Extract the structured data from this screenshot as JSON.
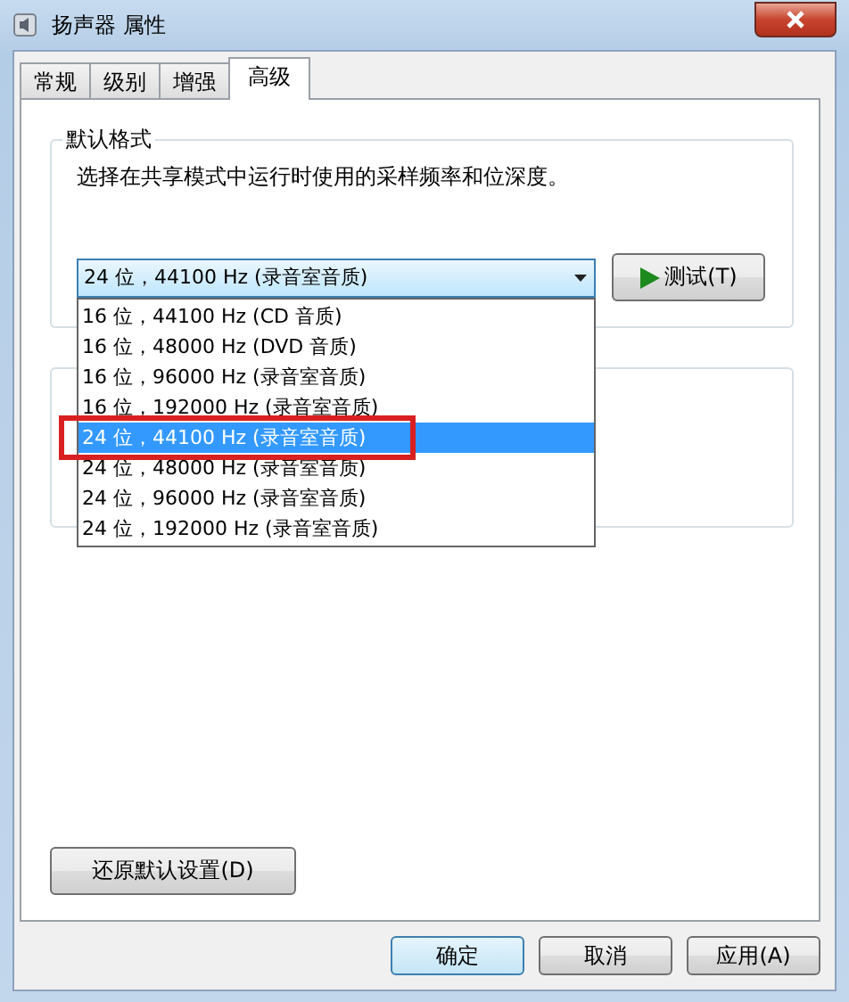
{
  "window": {
    "title": "扬声器 属性"
  },
  "tabs": [
    {
      "label": "常规",
      "selected": false
    },
    {
      "label": "级别",
      "selected": false
    },
    {
      "label": "增强",
      "selected": false
    },
    {
      "label": "高级",
      "selected": true
    }
  ],
  "default_format": {
    "title": "默认格式",
    "description": "选择在共享模式中运行时使用的采样频率和位深度。",
    "dropdown": {
      "value": "24 位，44100 Hz (录音室音质)",
      "expanded": true,
      "options": [
        {
          "label": "16 位，44100 Hz (CD 音质)",
          "selected": false,
          "marked": false
        },
        {
          "label": "16 位，48000 Hz (DVD 音质)",
          "selected": false,
          "marked": false
        },
        {
          "label": "16 位，96000 Hz (录音室音质)",
          "selected": false,
          "marked": false
        },
        {
          "label": "16 位，192000 Hz (录音室音质)",
          "selected": false,
          "marked": false
        },
        {
          "label": "24 位，44100 Hz (录音室音质)",
          "selected": true,
          "marked": true
        },
        {
          "label": "24 位，48000 Hz (录音室音质)",
          "selected": false,
          "marked": false
        },
        {
          "label": "24 位，96000 Hz (录音室音质)",
          "selected": false,
          "marked": false
        },
        {
          "label": "24 位，192000 Hz (录音室音质)",
          "selected": false,
          "marked": false
        }
      ]
    },
    "test_button": "测试(T)"
  },
  "restore_button": "还原默认设置(D)",
  "buttons": [
    {
      "label": "确定",
      "default": true
    },
    {
      "label": "取消",
      "default": false
    },
    {
      "label": "应用(A)",
      "default": false
    }
  ]
}
